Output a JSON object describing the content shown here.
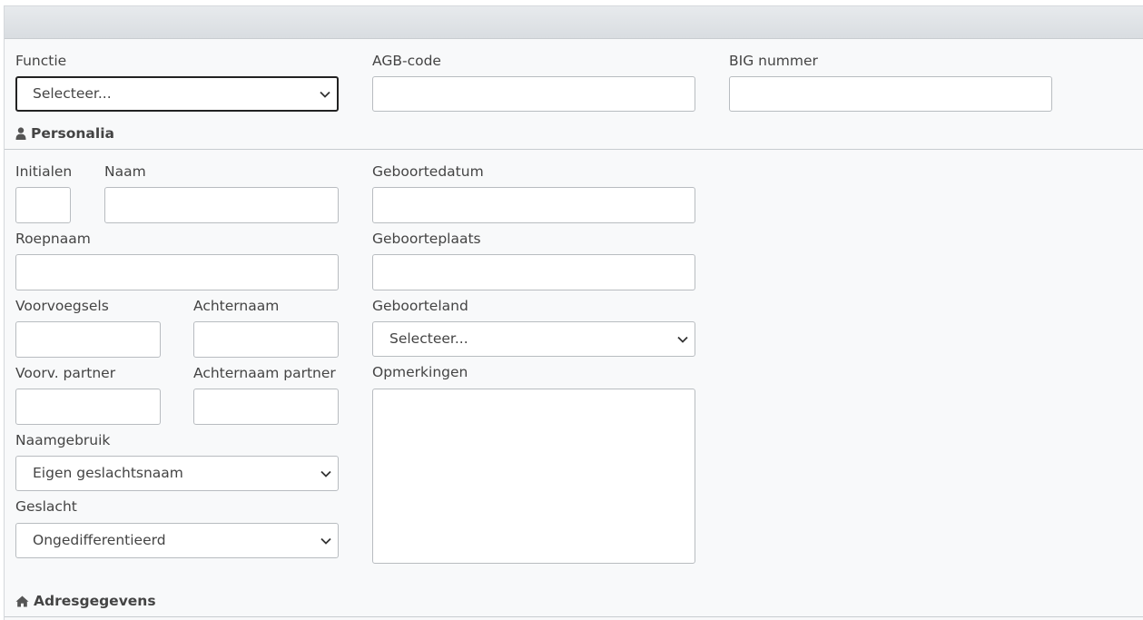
{
  "fields": {
    "functie": {
      "label": "Functie",
      "value": "Selecteer..."
    },
    "agb": {
      "label": "AGB-code"
    },
    "big": {
      "label": "BIG nummer"
    },
    "initialen": {
      "label": "Initialen"
    },
    "naam": {
      "label": "Naam"
    },
    "geboortedatum": {
      "label": "Geboortedatum"
    },
    "roepnaam": {
      "label": "Roepnaam"
    },
    "geboorteplaats": {
      "label": "Geboorteplaats"
    },
    "voorvoegsels": {
      "label": "Voorvoegsels"
    },
    "achternaam": {
      "label": "Achternaam"
    },
    "geboorteland": {
      "label": "Geboorteland",
      "value": "Selecteer..."
    },
    "voorv_partner": {
      "label": "Voorv. partner"
    },
    "achternaam_partner": {
      "label": "Achternaam partner"
    },
    "opmerkingen": {
      "label": "Opmerkingen"
    },
    "naamgebruik": {
      "label": "Naamgebruik",
      "value": "Eigen geslachtsnaam"
    },
    "geslacht": {
      "label": "Geslacht",
      "value": "Ongedifferentieerd"
    }
  },
  "sections": {
    "personalia": {
      "title": "Personalia",
      "icon": "user-icon"
    },
    "adresgegevens": {
      "title": "Adresgegevens",
      "icon": "home-icon"
    }
  }
}
